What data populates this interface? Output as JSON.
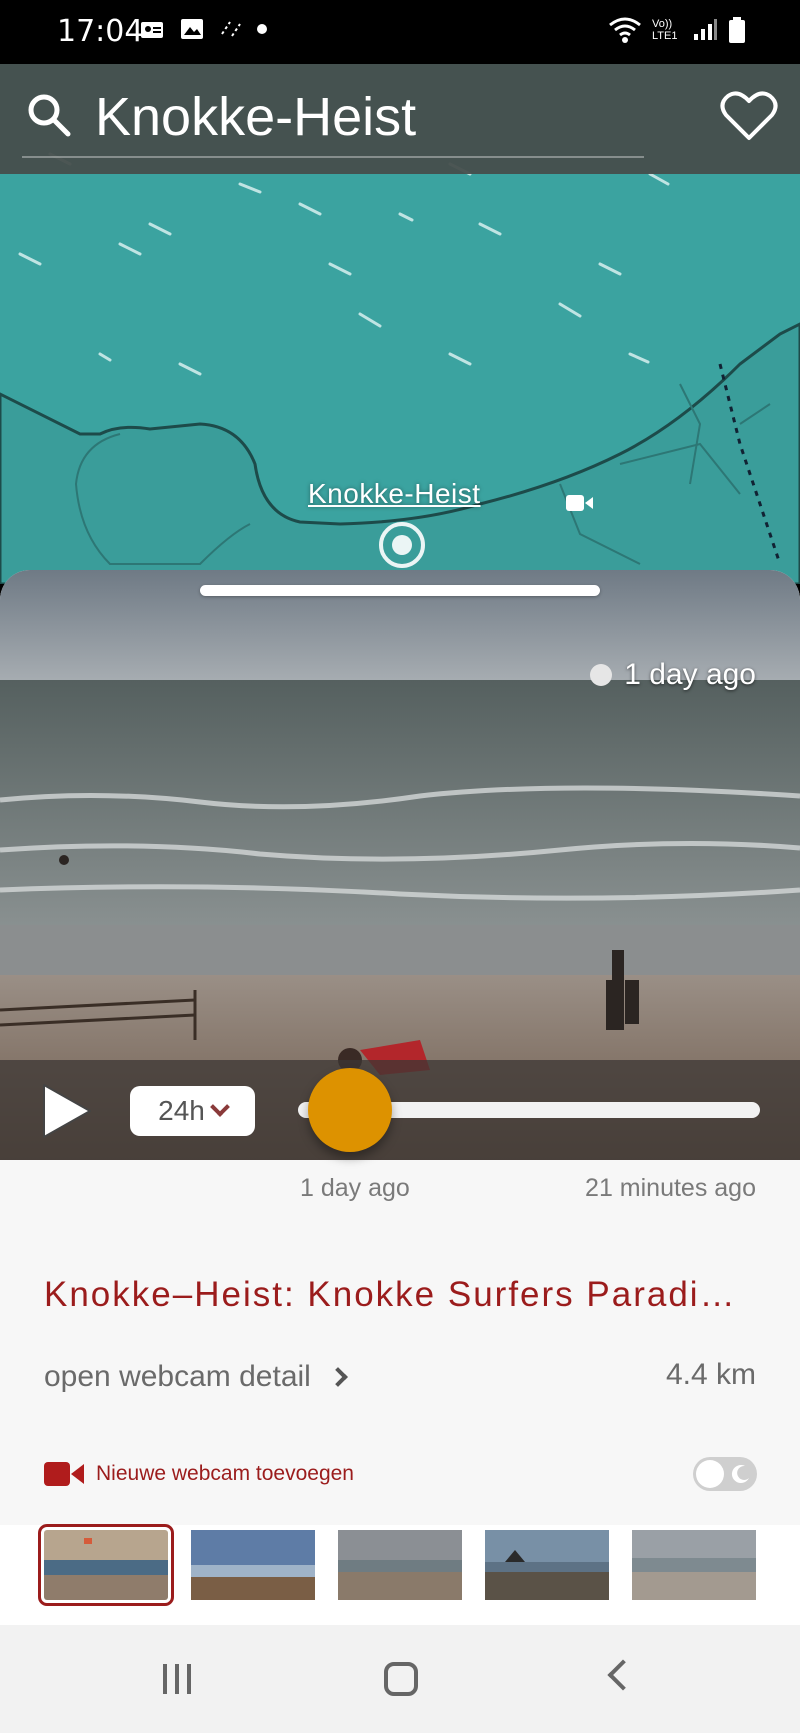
{
  "status_bar": {
    "time": "17:04",
    "network_label": "Vo)) LTE1"
  },
  "header": {
    "search_value": "Knokke-Heist",
    "icons": [
      "search-icon",
      "heart-icon"
    ]
  },
  "map": {
    "place_label": "Knokke-Heist",
    "colors": {
      "sea": "#3ba3a0",
      "land": "#3ba3a0"
    }
  },
  "webcam": {
    "timestamp": "1 day ago",
    "range_value": "24h",
    "slider_start_label": "1 day ago",
    "slider_end_label": "21 minutes ago",
    "slider_position": 0.06,
    "title": "Knokke–Heist: Knokke Surfers Paradi…",
    "detail_link": "open webcam detail",
    "distance": "4.4 km",
    "add_webcam": "Nieuwe webcam toevoegen"
  },
  "thumbnails": [
    {
      "selected": true
    },
    {
      "selected": false
    },
    {
      "selected": false
    },
    {
      "selected": false
    },
    {
      "selected": false
    }
  ],
  "colors": {
    "accent": "#9b1c1c",
    "slider_thumb": "#dd9200"
  }
}
